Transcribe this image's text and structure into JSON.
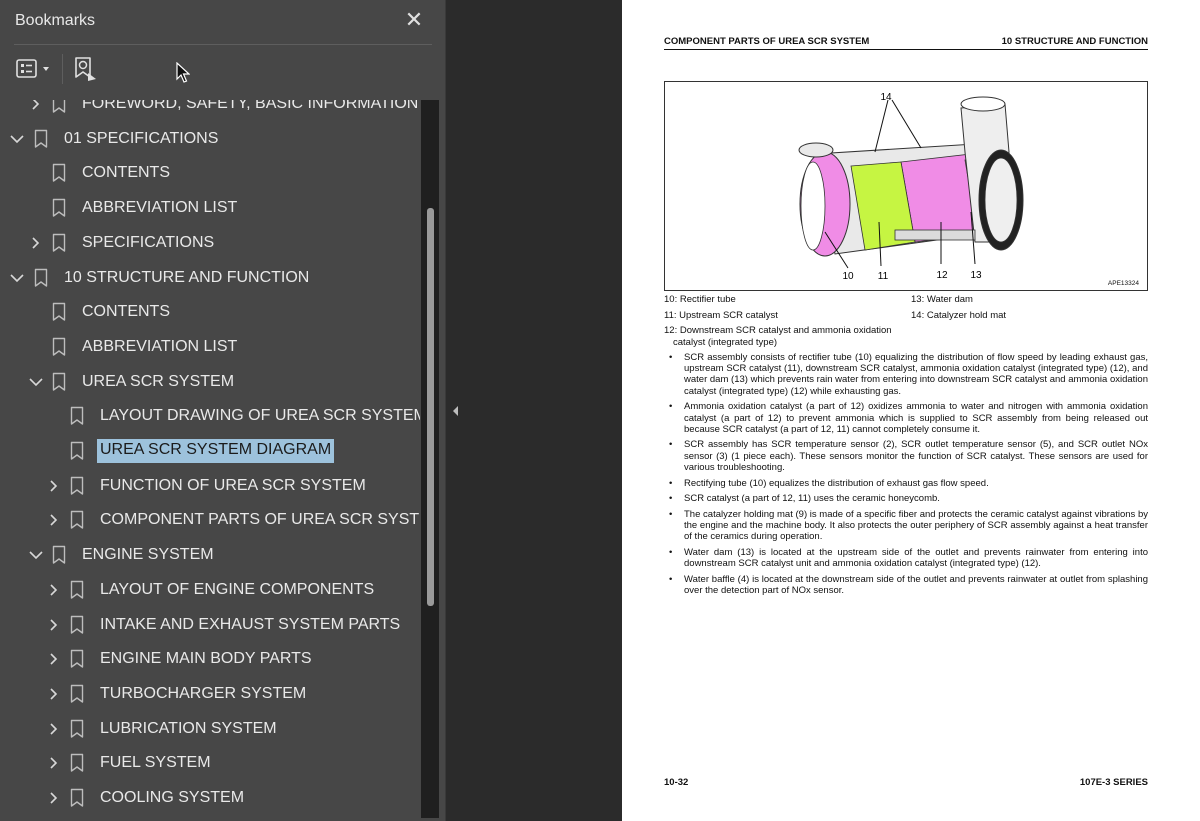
{
  "sidebar": {
    "title": "Bookmarks",
    "close_glyph": "✕",
    "toolbar": {
      "options_icon": "list-options-icon",
      "find_icon": "find-bookmark-icon"
    }
  },
  "bookmarks": [
    {
      "label": "FOREWORD, SAFETY, BASIC INFORMATION",
      "level": 1,
      "chevron": "right",
      "partial": true
    },
    {
      "label": "01 SPECIFICATIONS",
      "level": 0,
      "chevron": "down"
    },
    {
      "label": "CONTENTS",
      "level": 1,
      "chevron": "none"
    },
    {
      "label": "ABBREVIATION LIST",
      "level": 1,
      "chevron": "none"
    },
    {
      "label": "SPECIFICATIONS",
      "level": 1,
      "chevron": "right"
    },
    {
      "label": "10 STRUCTURE AND FUNCTION",
      "level": 0,
      "chevron": "down"
    },
    {
      "label": "CONTENTS",
      "level": 1,
      "chevron": "none"
    },
    {
      "label": "ABBREVIATION LIST",
      "level": 1,
      "chevron": "none"
    },
    {
      "label": "UREA SCR SYSTEM",
      "level": 1,
      "chevron": "down"
    },
    {
      "label": "LAYOUT DRAWING OF UREA SCR SYSTEM",
      "level": 2,
      "chevron": "none"
    },
    {
      "label": "UREA SCR SYSTEM DIAGRAM",
      "level": 2,
      "chevron": "none",
      "selected": true
    },
    {
      "label": "FUNCTION OF UREA SCR SYSTEM",
      "level": 2,
      "chevron": "right"
    },
    {
      "label": "COMPONENT PARTS OF UREA SCR SYSTEM",
      "level": 2,
      "chevron": "right"
    },
    {
      "label": "ENGINE SYSTEM",
      "level": 1,
      "chevron": "down"
    },
    {
      "label": "LAYOUT OF ENGINE COMPONENTS",
      "level": 2,
      "chevron": "right"
    },
    {
      "label": "INTAKE AND EXHAUST SYSTEM PARTS",
      "level": 2,
      "chevron": "right"
    },
    {
      "label": "ENGINE MAIN BODY PARTS",
      "level": 2,
      "chevron": "right"
    },
    {
      "label": "TURBOCHARGER SYSTEM",
      "level": 2,
      "chevron": "right"
    },
    {
      "label": "LUBRICATION SYSTEM",
      "level": 2,
      "chevron": "right"
    },
    {
      "label": "FUEL SYSTEM",
      "level": 2,
      "chevron": "right"
    },
    {
      "label": "COOLING SYSTEM",
      "level": 2,
      "chevron": "right"
    }
  ],
  "page": {
    "header_left": "COMPONENT PARTS OF UREA SCR SYSTEM",
    "header_right": "10 STRUCTURE AND FUNCTION",
    "figure": {
      "callouts": [
        "14",
        "10",
        "11",
        "12",
        "13"
      ],
      "code": "APE13324"
    },
    "captions": {
      "c10": "10: Rectifier tube",
      "c11": "11: Upstream SCR catalyst",
      "c12a": "12: Downstream SCR catalyst and ammonia oxidation",
      "c12b": "catalyst (integrated type)",
      "c13": "13: Water dam",
      "c14": "14: Catalyzer hold mat"
    },
    "bullets": [
      "SCR assembly consists of rectifier tube (10) equalizing the distribution of flow speed by leading exhaust gas, upstream SCR catalyst (11), downstream SCR catalyst, ammonia oxidation catalyst (integrated type) (12), and water dam (13) which prevents rain water from entering into downstream SCR catalyst and ammonia oxidation catalyst (integrated type) (12) while exhausting gas.",
      "Ammonia oxidation catalyst (a part of 12) oxidizes ammonia to water and nitrogen with ammonia oxidation catalyst (a part of 12) to prevent ammonia which is supplied to SCR assembly from being released out because SCR catalyst (a part of 12, 11) cannot completely consume it.",
      "SCR assembly has SCR temperature sensor (2), SCR outlet temperature sensor (5), and SCR outlet NOx sensor (3) (1 piece each). These sensors monitor the function of SCR catalyst. These sensors are used for various troubleshooting.",
      "Rectifying tube (10) equalizes the distribution of exhaust gas flow speed.",
      "SCR catalyst (a part of 12, 11) uses the ceramic honeycomb.",
      "The catalyzer holding mat (9) is made of a specific fiber and protects the ceramic catalyst against vibrations by the engine and the machine body. It also protects the outer periphery of SCR assembly against a heat transfer of the ceramics during operation.",
      "Water dam (13) is located at the upstream side of the outlet and prevents rainwater from entering into downstream SCR catalyst unit and ammonia oxidation catalyst (integrated type) (12).",
      "Water baffle (4) is located at the downstream side of the outlet and prevents rainwater at outlet from splashing over the detection part of NOx sensor."
    ],
    "footer_left": "10-32",
    "footer_right": "107E-3 SERIES"
  },
  "colors": {
    "panel": "#474747",
    "selection": "#9dc2dc",
    "highlight_pink": "#f08ce6",
    "highlight_green": "#c6f542"
  }
}
